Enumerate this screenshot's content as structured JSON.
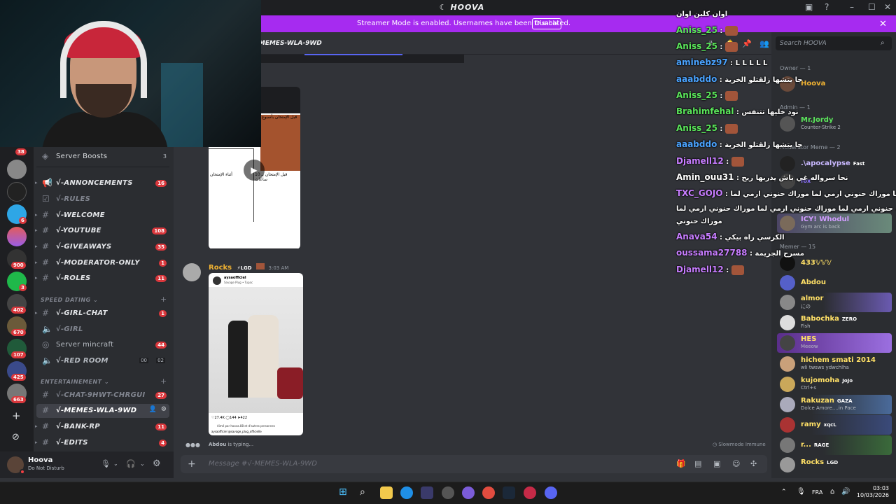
{
  "app": {
    "title": "HOOVA"
  },
  "banner": {
    "text": "Streamer Mode is enabled. Usernames have been truncated.",
    "button": "Disable"
  },
  "chat_header": {
    "channel": "√-MEMES-WLA-9WD"
  },
  "server_rail": {
    "badges": [
      "38",
      "6",
      "900",
      "3",
      "402",
      "670",
      "107",
      "425",
      "663"
    ]
  },
  "channels": {
    "server_boosts": {
      "label": "Server Boosts",
      "count": "3"
    },
    "items": [
      {
        "name": "√-ANNONCEMENTS",
        "badge": "16"
      },
      {
        "name": "√-RULES",
        "badge": ""
      },
      {
        "name": "√-WELCOME",
        "badge": ""
      },
      {
        "name": "√-YOUTUBE",
        "badge": "108"
      },
      {
        "name": "√-GIVEAWAYS",
        "badge": "35"
      },
      {
        "name": "√-MODERATOR-ONLY",
        "badge": "1"
      },
      {
        "name": "√-ROLES",
        "badge": "11"
      }
    ],
    "cat_speed": "SPEED DATING",
    "speed_items": [
      {
        "name": "√-GIRL-CHAT",
        "badge": "1"
      },
      {
        "name": "√-GIRL",
        "badge": ""
      },
      {
        "name": "Server mincraft",
        "badge": "44"
      },
      {
        "name": "√-RED ROOM",
        "badge": ""
      }
    ],
    "red_room_timer": [
      "00",
      "02"
    ],
    "cat_ent": "ENTERTAINEMENT",
    "ent_items": [
      {
        "name": "√-CHAT-9HWT-CHRGUI",
        "badge": "27"
      },
      {
        "name": "√-MEMES-WLA-9WD",
        "badge": ""
      },
      {
        "name": "√-BANK-RP",
        "badge": "11"
      },
      {
        "name": "√-EDITS",
        "badge": "4"
      }
    ]
  },
  "user_panel": {
    "name": "Hoova",
    "status": "Do Not Disturb"
  },
  "messages": {
    "author": "Rocks",
    "tag": "LGD",
    "time": "3:03 AM",
    "media1_top_text": "قبل الإمتحان بأسبوع",
    "media1_bottom_left": "أثناء الإمتحان",
    "media1_bottom_right": "قبل الإمتحان بـ 10 ساعات",
    "media2": {
      "account": "aysaofficiel",
      "subtitle": "Savage Plug • Tupac",
      "likes": "27.4K",
      "comments": "144",
      "shares": "422",
      "liked_by": "Aimé par hoova.88 et d'autres personnes",
      "caption": "aysaofficiel @savage_plug_officielle"
    }
  },
  "typing": {
    "user": "Abdou",
    "text": "is typing..."
  },
  "slowmode": "Slowmode Immune",
  "composer": {
    "placeholder": "Message #√-MEMES-WLA-9WD"
  },
  "overlay_chat": [
    {
      "user": "",
      "color": "#c9a0ff",
      "msg": "اوان كلين اوان"
    },
    {
      "user": "Aniss_25",
      "color": "#5be65b",
      "msg": ""
    },
    {
      "user": "Aniss_25",
      "color": "#5be65b",
      "msg": ""
    },
    {
      "user": "aminebz97",
      "color": "#4aa3ff",
      "msg": "L L L L L"
    },
    {
      "user": "aaabddo",
      "color": "#4aa3ff",
      "msg": "جا يتشها زلقتلو الخرية"
    },
    {
      "user": "Aniss_25",
      "color": "#5be65b",
      "msg": ""
    },
    {
      "user": "Brahimfehal",
      "color": "#5be65b",
      "msg": "نود خليها تتنفس"
    },
    {
      "user": "Aniss_25",
      "color": "#5be65b",
      "msg": ""
    },
    {
      "user": "aaabddo",
      "color": "#4aa3ff",
      "msg": "جا يتشها زلقتلو الخرية"
    },
    {
      "user": "Djamell12",
      "color": "#c77dff",
      "msg": ""
    },
    {
      "user": "Amin_ouu31",
      "color": "#ffffff",
      "msg": "نحا سرواله غي باش يدربها ريح"
    },
    {
      "user": "TXC_GOJO",
      "color": "#c77dff",
      "msg": "ارمي لما موراك حنوني ارمي لما موراك حنوني ارمي لما"
    },
    {
      "user": "",
      "color": "#ffffff",
      "msg": "موراك حنوني ارمي لما موراك حنوني ارمي لما موراك حنوني ارمي لما"
    },
    {
      "user": "",
      "color": "#ffffff",
      "msg": "موراك حنوني"
    },
    {
      "user": "Anava54",
      "color": "#c77dff",
      "msg": "الكرسي راه بيكي"
    },
    {
      "user": "oussama27788",
      "color": "#c77dff",
      "msg": "مسرح الجريمة"
    },
    {
      "user": "Djamell12",
      "color": "#c77dff",
      "msg": ""
    }
  ],
  "members": {
    "search_placeholder": "Search HOOVA",
    "roles": {
      "owner": "Owner — 1",
      "admin": "Admin — 1",
      "moderator": "Moderator Meme — 2",
      "memer": "Memer — 15"
    },
    "owner_list": [
      {
        "name": "Hoova",
        "sub": "",
        "tag": "",
        "color": "#f0b232",
        "av": "#6b4a3a"
      }
    ],
    "admin_list": [
      {
        "name": "Mr.Jordy",
        "sub": "Counter-Strike 2",
        "tag": "",
        "color": "#5be65b",
        "av": "#555"
      }
    ],
    "mod_list": [
      {
        "name": ".\\apocalypse",
        "sub": "",
        "tag": "Fast",
        "color": "#c9b8ff",
        "av": "#222"
      },
      {
        "name": "fox",
        "sub": "",
        "tag": "",
        "color": "#8b70ff",
        "av": "#444"
      },
      {
        "name": "ICY! Whodul",
        "sub": "Gym arc is back",
        "tag": "",
        "color": "#d19cff",
        "av": "#7a6a5a"
      }
    ],
    "memer_list": [
      {
        "name": "433𝕍𝕍𝕍",
        "sub": "",
        "tag": "",
        "color": "#ffe066",
        "av": "#111"
      },
      {
        "name": "Abdou",
        "sub": "",
        "tag": "",
        "color": "#ffe066",
        "av": "#5560c9"
      },
      {
        "name": "almor",
        "sub": "にの",
        "tag": "",
        "color": "#ffe066",
        "av": "#888"
      },
      {
        "name": "Babochka",
        "sub": "Fish",
        "tag": "ZERO",
        "color": "#ffe066",
        "av": "#ddd"
      },
      {
        "name": "HES",
        "sub": "Meeow",
        "tag": "",
        "color": "#ffe066",
        "av": "#444"
      },
      {
        "name": "hichem smati 2014",
        "sub": "wli twsws ydwchlha",
        "tag": "",
        "color": "#ffe066",
        "av": "#c9a07a"
      },
      {
        "name": "kujomoha",
        "sub": "Ctrl+s",
        "tag": "JoJo",
        "color": "#ffe066",
        "av": "#caa85a"
      },
      {
        "name": "Rakuzan",
        "sub": "Dolce Amore....in Pace",
        "tag": "GAZA",
        "color": "#ffe066",
        "av": "#aab"
      },
      {
        "name": "ramy",
        "sub": "",
        "tag": "xqcL",
        "color": "#ffe066",
        "av": "#a33"
      },
      {
        "name": "r...",
        "sub": "",
        "tag": "RAGE",
        "color": "#ffe066",
        "av": "#777"
      },
      {
        "name": "Rocks",
        "sub": "",
        "tag": "LGD",
        "color": "#ffe066",
        "av": "#999"
      }
    ]
  },
  "taskbar": {
    "lang": "FRA",
    "time": "03:03",
    "date": "10/03/2026"
  }
}
